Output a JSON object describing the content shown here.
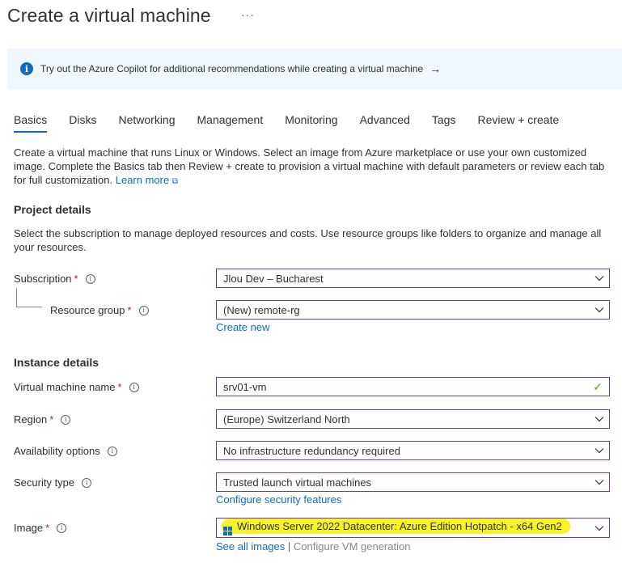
{
  "page": {
    "title": "Create a virtual machine",
    "more": "···"
  },
  "banner": {
    "text": "Try out the Azure Copilot for additional recommendations while creating a virtual machine",
    "arrow": "→",
    "icon": "info-icon"
  },
  "tabs": [
    {
      "label": "Basics",
      "active": true
    },
    {
      "label": "Disks"
    },
    {
      "label": "Networking"
    },
    {
      "label": "Management"
    },
    {
      "label": "Monitoring"
    },
    {
      "label": "Advanced"
    },
    {
      "label": "Tags"
    },
    {
      "label": "Review + create"
    }
  ],
  "intro": {
    "text": "Create a virtual machine that runs Linux or Windows. Select an image from Azure marketplace or use your own customized image. Complete the Basics tab then Review + create to provision a virtual machine with default parameters or review each tab for full customization.",
    "learn_more": "Learn more"
  },
  "project": {
    "title": "Project details",
    "desc": "Select the subscription to manage deployed resources and costs. Use resource groups like folders to organize and manage all your resources.",
    "subscription": {
      "label": "Subscription",
      "value": "Jlou Dev – Bucharest"
    },
    "resource_group": {
      "label": "Resource group",
      "value": "(New) remote-rg",
      "create_new": "Create new"
    }
  },
  "instance": {
    "title": "Instance details",
    "vm_name": {
      "label": "Virtual machine name",
      "value": "srv01-vm"
    },
    "region": {
      "label": "Region",
      "value": "(Europe) Switzerland North"
    },
    "availability": {
      "label": "Availability options",
      "value": "No infrastructure redundancy required"
    },
    "security": {
      "label": "Security type",
      "value": "Trusted launch virtual machines",
      "configure": "Configure security features"
    },
    "image": {
      "label": "Image",
      "value": "Windows Server 2022 Datacenter: Azure Edition Hotpatch - x64 Gen2",
      "see_all": "See all images",
      "separator": "|",
      "configure_gen": "Configure VM generation"
    }
  },
  "colors": {
    "accent": "#0f6cbd",
    "field_border": "#6b3d9a",
    "required": "#a4262c",
    "highlight": "#f9f325",
    "valid": "#57a300"
  }
}
